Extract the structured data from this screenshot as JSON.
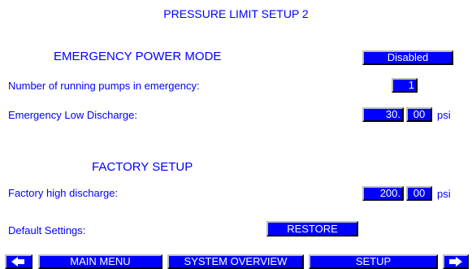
{
  "title": "PRESSURE LIMIT SETUP 2",
  "emergency": {
    "heading": "EMERGENCY POWER MODE",
    "mode_value": "Disabled",
    "pumps_label": "Number of running pumps in emergency:",
    "pumps_value": "1",
    "low_discharge_label": "Emergency Low Discharge:",
    "low_discharge_int": "30.",
    "low_discharge_dec": "00",
    "low_discharge_unit": "psi"
  },
  "factory": {
    "heading": "FACTORY SETUP",
    "high_discharge_label": "Factory high discharge:",
    "high_discharge_int": "200.",
    "high_discharge_dec": "00",
    "high_discharge_unit": "psi",
    "default_label": "Default Settings:",
    "restore_label": "RESTORE"
  },
  "nav": {
    "prev_icon": "arrow-left-icon",
    "main_menu": "MAIN MENU",
    "system_overview": "SYSTEM OVERVIEW",
    "setup": "SETUP",
    "next_icon": "arrow-right-icon"
  },
  "colors": {
    "text": "#0000ff",
    "field_bg": "#0000ff",
    "field_text": "#ffffff",
    "background": "#ffffff"
  }
}
